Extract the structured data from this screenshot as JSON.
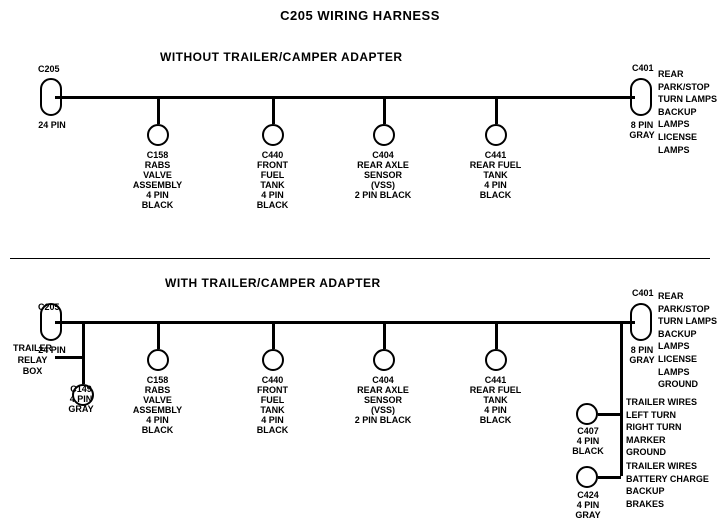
{
  "title": "C205 WIRING HARNESS",
  "section1": {
    "label": "WITHOUT  TRAILER/CAMPER ADAPTER",
    "connectors": [
      {
        "id": "C205_1",
        "label": "C205",
        "sublabel": "24 PIN"
      },
      {
        "id": "C401_1",
        "label": "C401",
        "sublabel": "8 PIN\nGRAY"
      },
      {
        "id": "C158_1",
        "label": "C158",
        "sublabel": "RABS VALVE\nASSEMBLY\n4 PIN BLACK"
      },
      {
        "id": "C440_1",
        "label": "C440",
        "sublabel": "FRONT FUEL\nTANK\n4 PIN BLACK"
      },
      {
        "id": "C404_1",
        "label": "C404",
        "sublabel": "REAR AXLE\nSENSOR\n(VSS)\n2 PIN BLACK"
      },
      {
        "id": "C441_1",
        "label": "C441",
        "sublabel": "REAR FUEL\nTANK\n4 PIN BLACK"
      }
    ],
    "right_label": "REAR PARK/STOP\nTURN LAMPS\nBACKUP LAMPS\nLICENSE LAMPS"
  },
  "section2": {
    "label": "WITH TRAILER/CAMPER ADAPTER",
    "connectors": [
      {
        "id": "C205_2",
        "label": "C205",
        "sublabel": "24 PIN"
      },
      {
        "id": "C401_2",
        "label": "C401",
        "sublabel": "8 PIN\nGRAY"
      },
      {
        "id": "C158_2",
        "label": "C158",
        "sublabel": "RABS VALVE\nASSEMBLY\n4 PIN BLACK"
      },
      {
        "id": "C440_2",
        "label": "C440",
        "sublabel": "FRONT FUEL\nTANK\n4 PIN BLACK"
      },
      {
        "id": "C404_2",
        "label": "C404",
        "sublabel": "REAR AXLE\nSENSOR\n(VSS)\n2 PIN BLACK"
      },
      {
        "id": "C441_2",
        "label": "C441",
        "sublabel": "REAR FUEL\nTANK\n4 PIN BLACK"
      },
      {
        "id": "C149",
        "label": "C149",
        "sublabel": "4 PIN GRAY"
      },
      {
        "id": "C407",
        "label": "C407",
        "sublabel": "4 PIN\nBLACK"
      },
      {
        "id": "C424",
        "label": "C424",
        "sublabel": "4 PIN\nGRAY"
      }
    ],
    "right_label1": "REAR PARK/STOP\nTURN LAMPS\nBACKUP LAMPS\nLICENSE LAMPS\nGROUND",
    "right_label2": "TRAILER WIRES\nLEFT TURN\nRIGHT TURN\nMARKER\nGROUND",
    "right_label3": "TRAILER WIRES\nBATTERY CHARGE\nBACKUP\nBRAKES",
    "trailer_relay": "TRAILER\nRELAY\nBOX"
  }
}
